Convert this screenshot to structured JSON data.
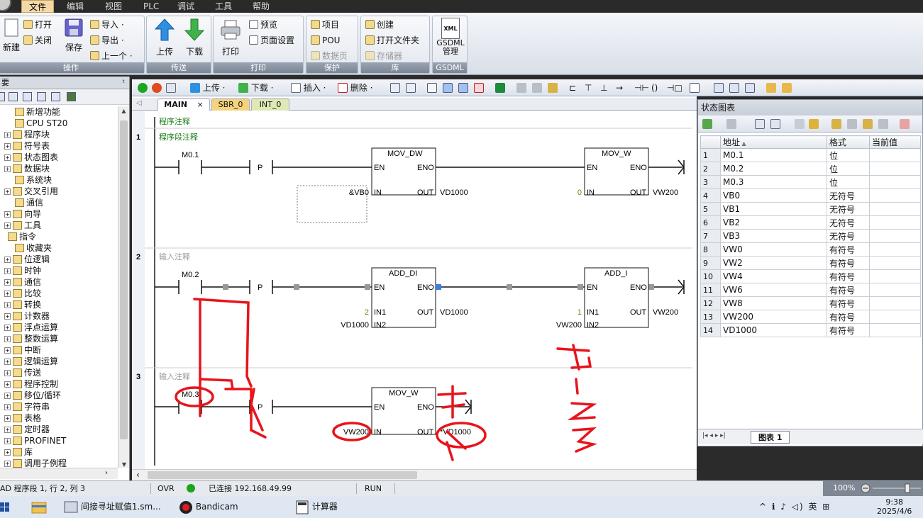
{
  "menu": {
    "items": [
      "文件",
      "编辑",
      "视图",
      "PLC",
      "调试",
      "工具",
      "帮助"
    ],
    "active": "文件"
  },
  "ribbon": {
    "groups": {
      "operate": "操作",
      "transfer": "传送",
      "print": "打印",
      "protect": "保护",
      "library": "库",
      "gsdml": "GSDML"
    },
    "buttons": {
      "new": "新建",
      "open": "打开",
      "close": "关闭",
      "save": "保存",
      "import": "导入 ·",
      "export": "导出 ·",
      "prev": "上一个 ·",
      "upload": "上传",
      "download": "下载",
      "print": "打印",
      "preview": "预览",
      "page_setup": "页面设置",
      "project": "项目",
      "pou": "POU",
      "data_page": "数据页",
      "create": "创建",
      "open_folder": "打开文件夹",
      "memory": "存储器",
      "gsdml_mgmt_1": "GSDML",
      "gsdml_mgmt_2": "管理",
      "xml": "XML"
    }
  },
  "left_panel": {
    "header": "要",
    "pin": "ᵗ",
    "tree": [
      {
        "label": "新增功能",
        "level": 1,
        "expand": ""
      },
      {
        "label": "CPU ST20",
        "level": 1,
        "expand": ""
      },
      {
        "label": "程序块",
        "level": 1,
        "expand": "+"
      },
      {
        "label": "符号表",
        "level": 1,
        "expand": "+"
      },
      {
        "label": "状态图表",
        "level": 1,
        "expand": "+"
      },
      {
        "label": "数据块",
        "level": 1,
        "expand": "+"
      },
      {
        "label": "系统块",
        "level": 1,
        "expand": ""
      },
      {
        "label": "交叉引用",
        "level": 1,
        "expand": "+"
      },
      {
        "label": "通信",
        "level": 1,
        "expand": ""
      },
      {
        "label": "向导",
        "level": 1,
        "expand": "+"
      },
      {
        "label": "工具",
        "level": 1,
        "expand": "+"
      },
      {
        "label": "指令",
        "level": 0,
        "expand": ""
      },
      {
        "label": "收藏夹",
        "level": 1,
        "expand": ""
      },
      {
        "label": "位逻辑",
        "level": 1,
        "expand": "+"
      },
      {
        "label": "时钟",
        "level": 1,
        "expand": "+"
      },
      {
        "label": "通信",
        "level": 1,
        "expand": "+"
      },
      {
        "label": "比较",
        "level": 1,
        "expand": "+"
      },
      {
        "label": "转换",
        "level": 1,
        "expand": "+"
      },
      {
        "label": "计数器",
        "level": 1,
        "expand": "+"
      },
      {
        "label": "浮点运算",
        "level": 1,
        "expand": "+"
      },
      {
        "label": "整数运算",
        "level": 1,
        "expand": "+"
      },
      {
        "label": "中断",
        "level": 1,
        "expand": "+"
      },
      {
        "label": "逻辑运算",
        "level": 1,
        "expand": "+"
      },
      {
        "label": "传送",
        "level": 1,
        "expand": "+"
      },
      {
        "label": "程序控制",
        "level": 1,
        "expand": "+"
      },
      {
        "label": "移位/循环",
        "level": 1,
        "expand": "+"
      },
      {
        "label": "字符串",
        "level": 1,
        "expand": "+"
      },
      {
        "label": "表格",
        "level": 1,
        "expand": "+"
      },
      {
        "label": "定时器",
        "level": 1,
        "expand": "+"
      },
      {
        "label": "PROFINET",
        "level": 1,
        "expand": "+"
      },
      {
        "label": "库",
        "level": 1,
        "expand": "+"
      },
      {
        "label": "调用子例程",
        "level": 1,
        "expand": "+"
      }
    ]
  },
  "editor_toolbar": {
    "upload": "上传 ·",
    "download": "下载 ·",
    "insert": "插入 ·",
    "delete": "删除 ·"
  },
  "editor_tabs": [
    {
      "label": "MAIN",
      "active": true,
      "close": "×"
    },
    {
      "label": "SBR_0",
      "active": false
    },
    {
      "label": "INT_0",
      "active": false
    }
  ],
  "ladder": {
    "program_comment": "程序注释",
    "networks": [
      {
        "num": "1",
        "comment": "程序段注释",
        "contact": "M0.1",
        "edge": "P",
        "box1": {
          "name": "MOV_DW",
          "en": "EN",
          "eno": "ENO",
          "in_label": "IN",
          "in_val": "&VB0",
          "out_label": "OUT",
          "out_val": "VD1000"
        },
        "box2": {
          "name": "MOV_W",
          "en": "EN",
          "eno": "ENO",
          "in_label": "IN",
          "in_val": "0",
          "out_label": "OUT",
          "out_val": "VW200"
        }
      },
      {
        "num": "2",
        "comment": "输入注释",
        "contact": "M0.2",
        "edge": "P",
        "box1": {
          "name": "ADD_DI",
          "en": "EN",
          "eno": "ENO",
          "in1_label": "IN1",
          "in1_val": "2",
          "in2_label": "IN2",
          "in2_val": "VD1000",
          "out_label": "OUT",
          "out_val": "VD1000"
        },
        "box2": {
          "name": "ADD_I",
          "en": "EN",
          "eno": "ENO",
          "in1_label": "IN1",
          "in1_val": "1",
          "in2_label": "IN2",
          "in2_val": "VW200",
          "out_label": "OUT",
          "out_val": "VW200"
        }
      },
      {
        "num": "3",
        "comment": "输入注释",
        "contact": "M0.3",
        "edge": "P",
        "box1": {
          "name": "MOV_W",
          "en": "EN",
          "eno": "ENO",
          "in_label": "IN",
          "in_val": "VW200",
          "out_label": "OUT",
          "out_val": "*VD1000"
        }
      }
    ]
  },
  "status_chart": {
    "title": "状态图表",
    "columns": [
      "",
      "地址",
      "格式",
      "当前值"
    ],
    "rows": [
      [
        "1",
        "M0.1",
        "位",
        ""
      ],
      [
        "2",
        "M0.2",
        "位",
        ""
      ],
      [
        "3",
        "M0.3",
        "位",
        ""
      ],
      [
        "4",
        "VB0",
        "无符号",
        ""
      ],
      [
        "5",
        "VB1",
        "无符号",
        ""
      ],
      [
        "6",
        "VB2",
        "无符号",
        ""
      ],
      [
        "7",
        "VB3",
        "无符号",
        ""
      ],
      [
        "8",
        "VW0",
        "有符号",
        ""
      ],
      [
        "9",
        "VW2",
        "有符号",
        ""
      ],
      [
        "10",
        "VW4",
        "有符号",
        ""
      ],
      [
        "11",
        "VW6",
        "有符号",
        ""
      ],
      [
        "12",
        "VW8",
        "有符号",
        ""
      ],
      [
        "13",
        "VW200",
        "有符号",
        ""
      ],
      [
        "14",
        "VD1000",
        "有符号",
        ""
      ]
    ],
    "tab": "图表 1",
    "nav": "|◂ ◂ ▸ ▸|"
  },
  "statusbar": {
    "position": "AD 程序段 1, 行 2, 列 3",
    "mode": "OVR",
    "connection": "已连接 192.168.49.99",
    "run": "RUN",
    "zoom": "100%"
  },
  "taskbar": {
    "apps": [
      "间接寻址赋值1.sm...",
      "Bandicam",
      "计算器"
    ],
    "tray": "^  ℹ  ♪  ◁)  英  ⊞",
    "time": "9:38",
    "date": "2025/4/6"
  },
  "colors": {
    "accent_green": "#1a7d1a",
    "annotation_red": "#e8141b",
    "run_green": "#19a619",
    "menu_active": "#f3d9a8"
  }
}
